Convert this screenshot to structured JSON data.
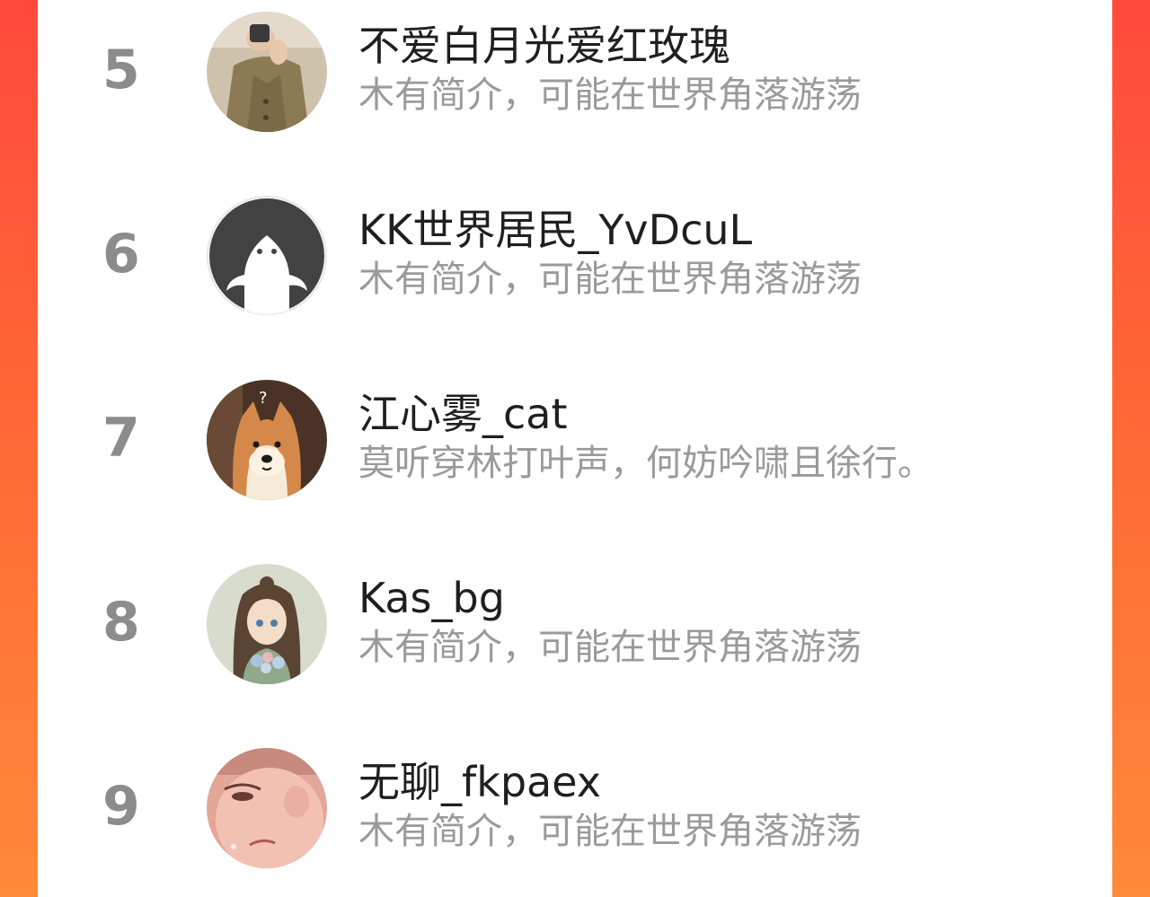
{
  "ranking": {
    "rows": [
      {
        "rank": "5",
        "name": "不爱白月光爱红玫瑰",
        "bio": "木有简介，可能在世界角落游荡",
        "avatar_icon": "avatar-woman-sweater-photo"
      },
      {
        "rank": "6",
        "name": "KK世界居民_YvDcuL",
        "bio": "木有简介，可能在世界角落游荡",
        "avatar_icon": "avatar-default-white-figure"
      },
      {
        "rank": "7",
        "name": "江心雾_cat",
        "bio": "莫听穿林打叶声，何妨吟啸且徐行。",
        "avatar_icon": "avatar-shiba-dog"
      },
      {
        "rank": "8",
        "name": "Kas_bg",
        "bio": "木有简介，可能在世界角落游荡",
        "avatar_icon": "avatar-anime-girl-flowers"
      },
      {
        "rank": "9",
        "name": "无聊_fkpaex",
        "bio": "木有简介，可能在世界角落游荡",
        "avatar_icon": "avatar-anime-face-closeup"
      }
    ]
  },
  "colors": {
    "background_top": "#ff4a3d",
    "background_bottom": "#ff8a3a",
    "rank_text": "#8c8c8c",
    "name_text": "#1f1f1f",
    "bio_text": "#9a9a9a",
    "card": "#ffffff"
  }
}
